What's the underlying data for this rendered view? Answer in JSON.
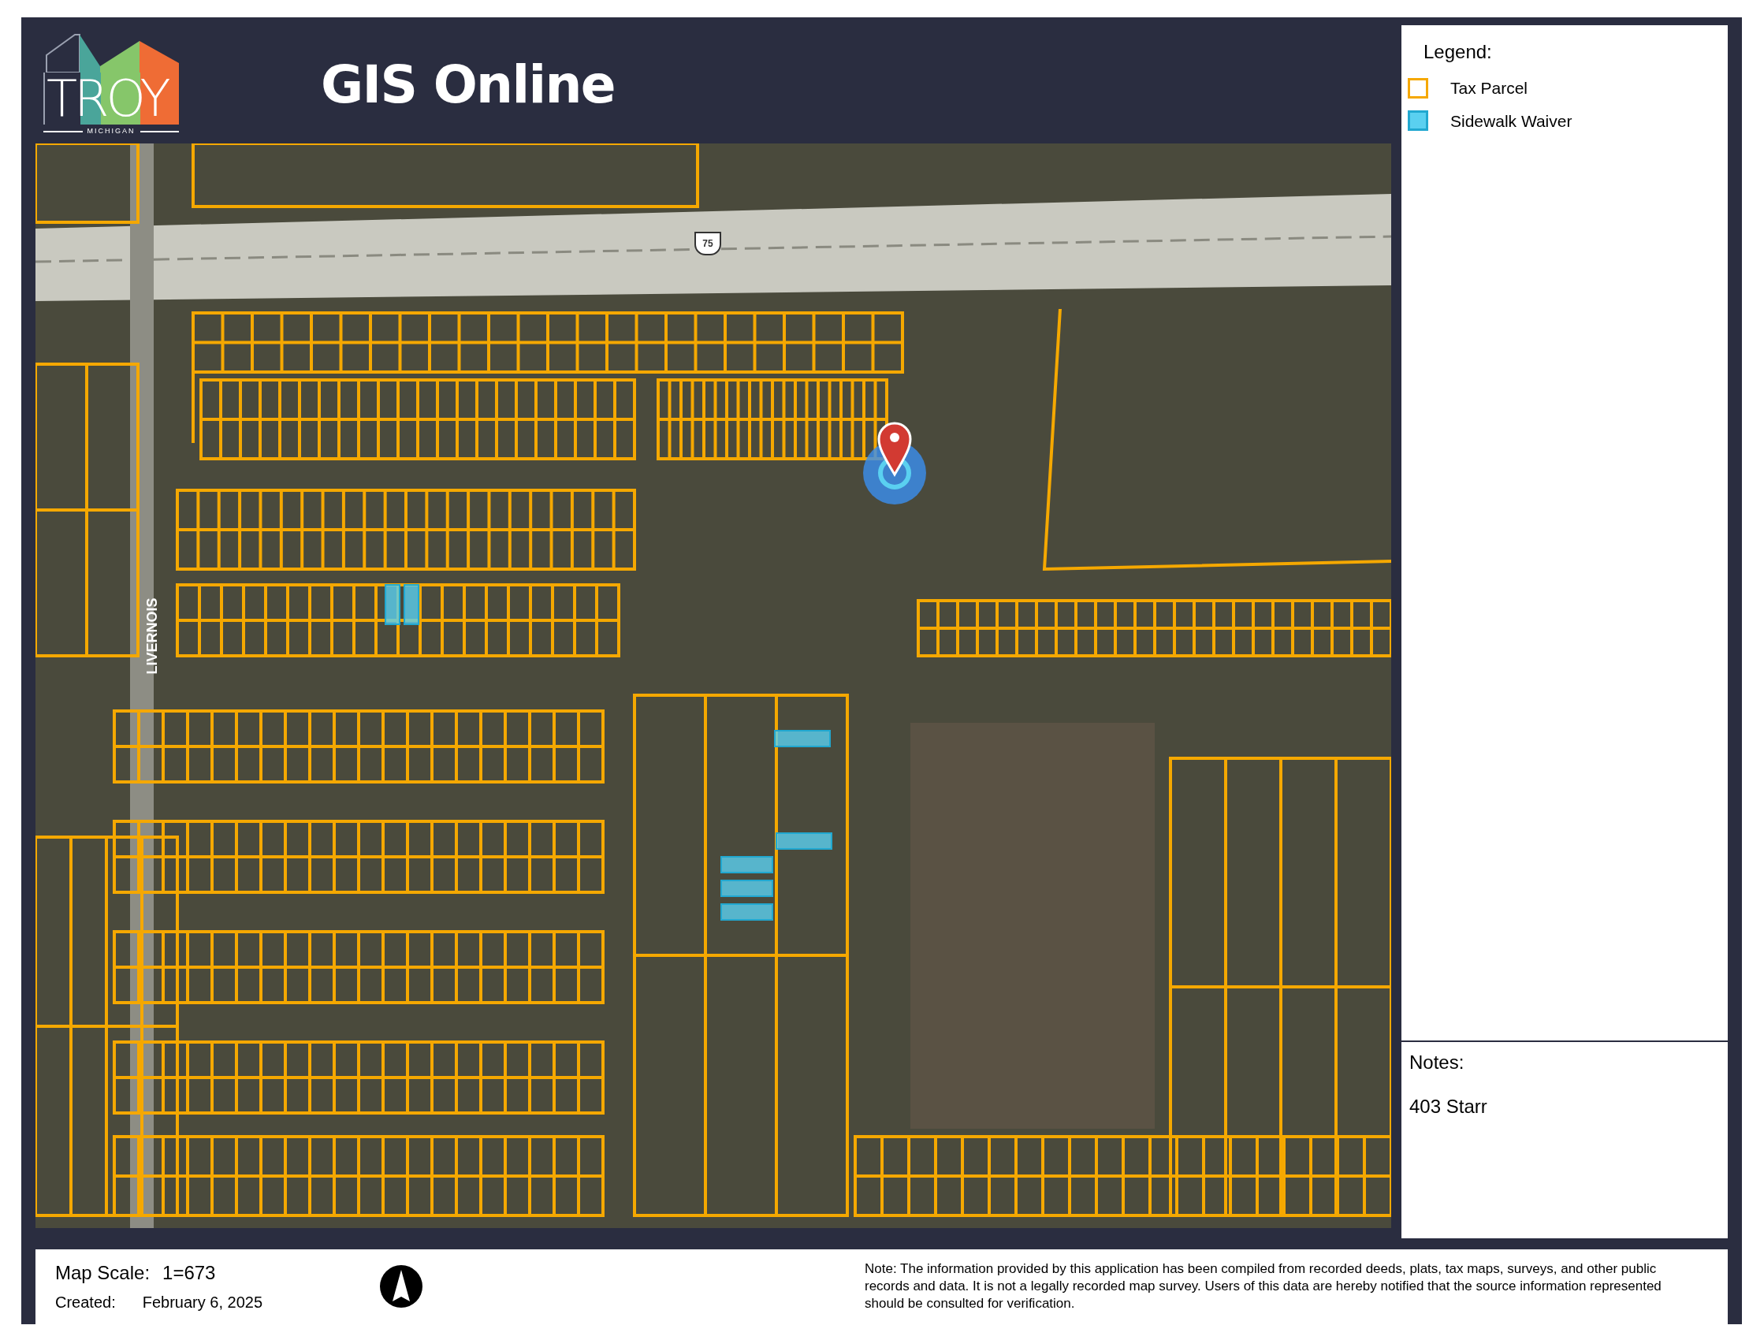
{
  "header": {
    "logo_word": "TROY",
    "logo_sub": "MICHIGAN",
    "title": "GIS Online"
  },
  "map": {
    "road_label": "LIVERNOIS",
    "highway_shield": "75"
  },
  "legend": {
    "title": "Legend:",
    "items": [
      {
        "label": "Tax Parcel",
        "kind": "outline",
        "color": "#f5a800"
      },
      {
        "label": "Sidewalk Waiver",
        "kind": "fill",
        "color": "#5ad0f0"
      }
    ]
  },
  "notes": {
    "title": "Notes:",
    "text": "403 Starr"
  },
  "footer": {
    "scale_label": "Map Scale:",
    "scale_value": "1=673",
    "created_label": "Created:",
    "created_value": "February 6, 2025",
    "note": "Note: The information provided by this application has been compiled from recorded deeds, plats, tax maps, surveys, and other public records and data. It is not a legally recorded map survey. Users of this data are hereby notified that the source information represented should be consulted for verification."
  }
}
